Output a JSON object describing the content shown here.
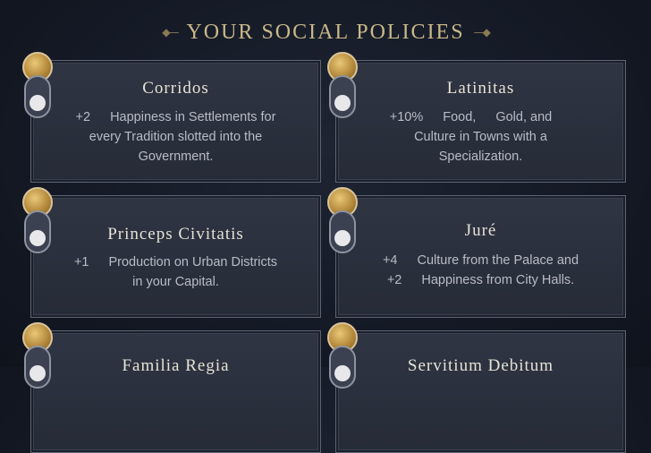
{
  "header": {
    "title": "YOUR SOCIAL POLICIES"
  },
  "policies": [
    {
      "name": "Corridos",
      "lines": [
        [
          "+2",
          "happiness-icon",
          "Happiness in Settlements for"
        ],
        [
          "every Tradition slotted into the"
        ],
        [
          "Government."
        ]
      ]
    },
    {
      "name": "Latinitas",
      "lines": [
        [
          "+10%",
          "food-icon",
          "Food,",
          "gold-icon",
          "Gold, and",
          "culture-icon"
        ],
        [
          "Culture in Towns with a"
        ],
        [
          "Specialization."
        ]
      ]
    },
    {
      "name": "Princeps Civitatis",
      "lines": [
        [
          "+1",
          "production-icon",
          "Production on Urban Districts"
        ],
        [
          "in your Capital."
        ]
      ]
    },
    {
      "name": "Juré",
      "lines": [
        [
          "+4",
          "culture-icon",
          "Culture from the Palace and"
        ],
        [
          "+2",
          "happiness-icon",
          "Happiness from City Halls."
        ]
      ]
    },
    {
      "name": "Familia Regia"
    },
    {
      "name": "Servitium Debitum"
    }
  ],
  "colors": {
    "title": "#c9b88a",
    "card_bg": "#2a2f3b",
    "card_border": "#5d6371",
    "text": "#b9bcc6"
  }
}
